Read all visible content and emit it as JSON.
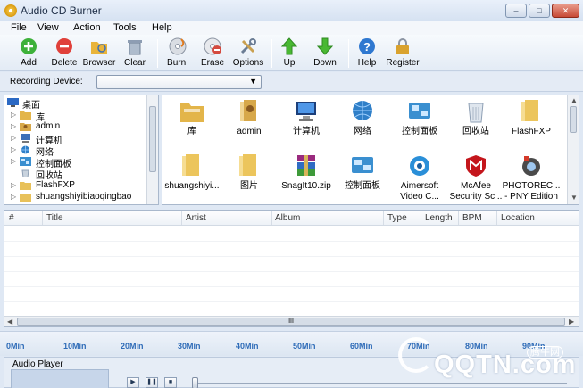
{
  "window": {
    "title": "Audio CD Burner",
    "controls": [
      "–",
      "□",
      "✕"
    ]
  },
  "menu": [
    "File",
    "View",
    "Action",
    "Tools",
    "Help"
  ],
  "toolbar": [
    {
      "label": "Add",
      "icon": "add-icon",
      "color": "#3db13a"
    },
    {
      "label": "Delete",
      "icon": "delete-icon",
      "color": "#e0403a"
    },
    {
      "label": "Browser",
      "icon": "browser-folder-icon",
      "color": "#e9b43a"
    },
    {
      "label": "Clear",
      "icon": "clear-icon",
      "color": "#8d9db3"
    },
    {
      "label": "Burn!",
      "icon": "burn-disc-icon",
      "color": "#c9ced6"
    },
    {
      "label": "Erase",
      "icon": "erase-disc-icon",
      "color": "#d44a3f"
    },
    {
      "label": "Options",
      "icon": "options-tools-icon",
      "color": "#6b7d95"
    },
    {
      "label": "Up",
      "icon": "up-arrow-icon",
      "color": "#49b833"
    },
    {
      "label": "Down",
      "icon": "down-arrow-icon",
      "color": "#49b833"
    },
    {
      "label": "Help",
      "icon": "help-icon",
      "color": "#2f78d0"
    },
    {
      "label": "Register",
      "icon": "lock-icon",
      "color": "#d9a22e"
    }
  ],
  "recording": {
    "label": "Recording Device:",
    "value": ""
  },
  "tree": [
    {
      "text": "桌面",
      "icon": "desktop-icon",
      "color": "#2b69c4",
      "expander": ""
    },
    {
      "text": "库",
      "icon": "library-folder-icon",
      "color": "#e3b54a",
      "expander": "▷"
    },
    {
      "text": "admin",
      "icon": "user-folder-icon",
      "color": "#d7a84a",
      "expander": "▷"
    },
    {
      "text": "计算机",
      "icon": "computer-icon",
      "color": "#3b6fb8",
      "expander": "▷"
    },
    {
      "text": "网络",
      "icon": "network-icon",
      "color": "#2f7fc8",
      "expander": "▷"
    },
    {
      "text": "控制面板",
      "icon": "control-panel-icon",
      "color": "#3a8fd0",
      "expander": "▷"
    },
    {
      "text": "回收站",
      "icon": "recycle-bin-icon",
      "color": "#8fa0b5",
      "expander": ""
    },
    {
      "text": "FlashFXP",
      "icon": "folder-icon",
      "color": "#e8c15a",
      "expander": "▷"
    },
    {
      "text": "shuangshiyibiaoqingbao",
      "icon": "folder-icon",
      "color": "#e8c15a",
      "expander": "▷"
    }
  ],
  "files": [
    {
      "label": "库",
      "icon": "library-folder-icon",
      "color": "#e3b54a"
    },
    {
      "label": "admin",
      "icon": "user-folder-icon",
      "color": "#d7a84a"
    },
    {
      "label": "计算机",
      "icon": "computer-icon",
      "color": "#3b6fb8"
    },
    {
      "label": "网络",
      "icon": "network-icon",
      "color": "#2f7fc8"
    },
    {
      "label": "控制面板",
      "icon": "control-panel-icon",
      "color": "#3a8fd0"
    },
    {
      "label": "回收站",
      "icon": "recycle-bin-icon",
      "color": "#8fa0b5"
    },
    {
      "label": "FlashFXP",
      "icon": "folder-icon",
      "color": "#ecc55c"
    },
    {
      "label": "shuangshiyi...",
      "icon": "folder-icon",
      "color": "#ecc55c"
    },
    {
      "label": "图片",
      "icon": "folder-icon",
      "color": "#ecc55c"
    },
    {
      "label": "SnagIt10.zip",
      "icon": "winrar-archive-icon",
      "color": "#9a2a7e"
    },
    {
      "label": "控制面板",
      "icon": "control-panel-icon",
      "color": "#3a8fd0"
    },
    {
      "label": "Aimersoft Video C...",
      "icon": "aimersoft-app-icon",
      "color": "#2a8fd8"
    },
    {
      "label": "McAfee Security Sc...",
      "icon": "mcafee-shield-icon",
      "color": "#c4161c"
    },
    {
      "label": "PHOTOREC... - PNY Edition",
      "icon": "photorec-app-icon",
      "color": "#4a4a4a"
    }
  ],
  "columns": [
    "#",
    "Title",
    "Artist",
    "Album",
    "Type",
    "Length",
    "BPM",
    "Location"
  ],
  "timeline": [
    "0Min",
    "10Min",
    "20Min",
    "30Min",
    "40Min",
    "50Min",
    "60Min",
    "70Min",
    "80Min",
    "90Min"
  ],
  "player": {
    "title": "Audio Player",
    "buttons": [
      "▶",
      "❚❚",
      "■"
    ]
  },
  "watermark": {
    "brand": "QQTN.com",
    "cn": "腾牛网"
  }
}
